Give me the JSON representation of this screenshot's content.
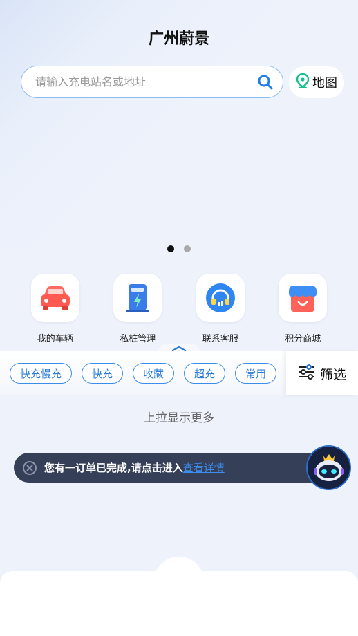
{
  "header": {
    "title": "广州蔚景"
  },
  "search": {
    "placeholder": "请输入充电站名或地址",
    "value": ""
  },
  "map_button": {
    "label": "地图"
  },
  "banner": {
    "dots": 2,
    "active_index": 0
  },
  "shortcuts": [
    {
      "label": "我的车辆",
      "icon": "car-icon"
    },
    {
      "label": "私桩管理",
      "icon": "charger-icon"
    },
    {
      "label": "联系客服",
      "icon": "headset-icon"
    },
    {
      "label": "积分商城",
      "icon": "shop-icon"
    }
  ],
  "filters": {
    "chips": [
      "快充慢充",
      "快充",
      "收藏",
      "超充",
      "常用"
    ],
    "filter_label": "筛选"
  },
  "hint": "上拉显示更多",
  "toast": {
    "message": "您有一订单已完成,请点击进入",
    "link": "查看详情"
  },
  "colors": {
    "accent": "#3a8de8",
    "toast_bg": "#353f58"
  }
}
